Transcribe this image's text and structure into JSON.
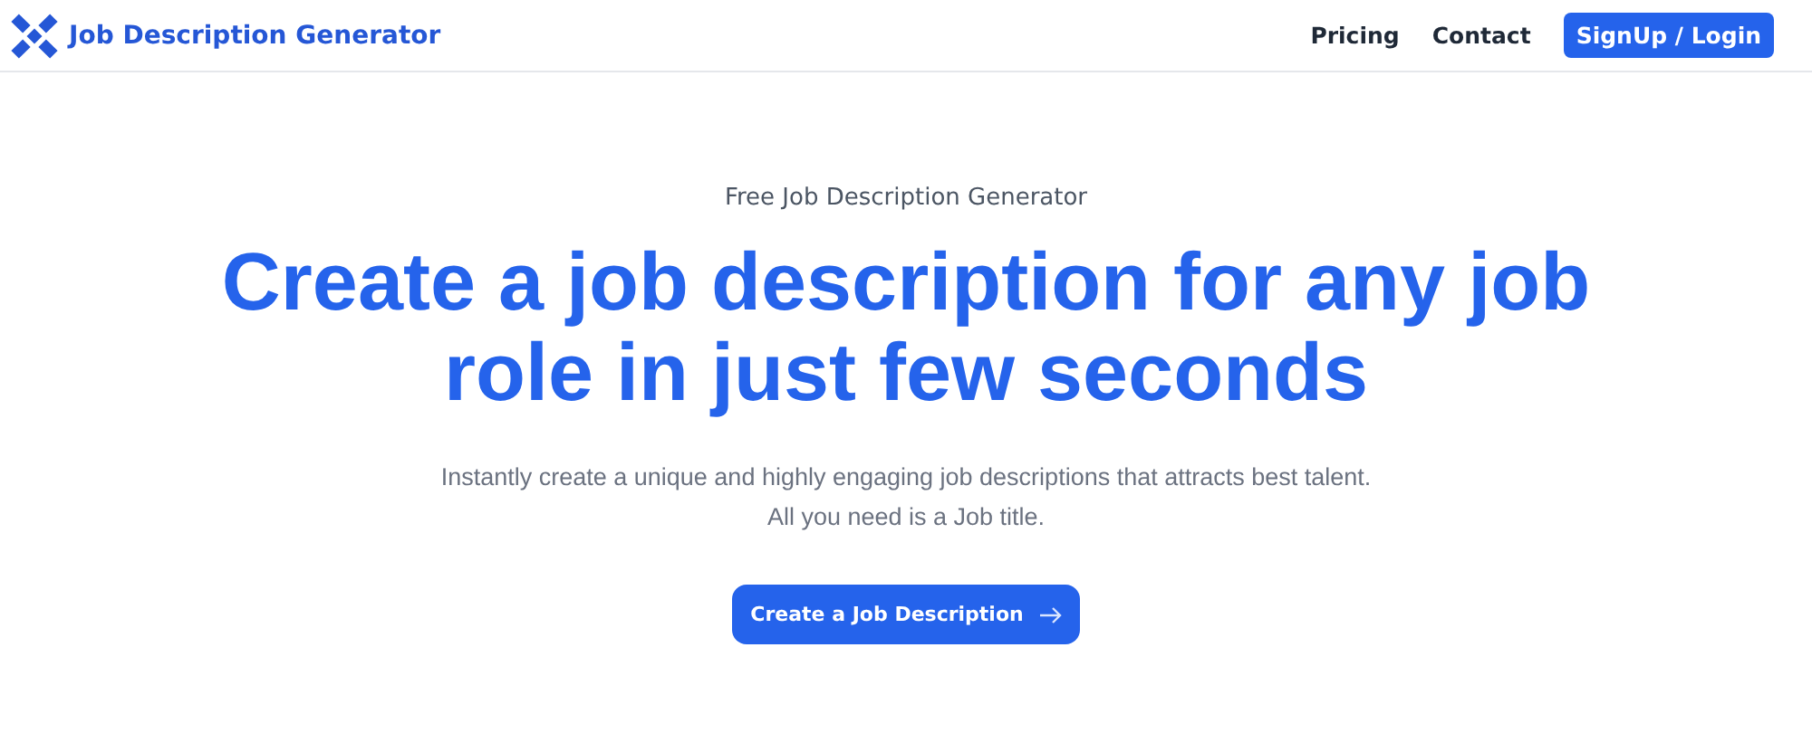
{
  "header": {
    "brand": "Job Description Generator",
    "nav": [
      {
        "label": "Pricing",
        "kind": "link"
      },
      {
        "label": "Contact",
        "kind": "link"
      },
      {
        "label": "SignUp / Login",
        "kind": "button"
      }
    ]
  },
  "hero": {
    "eyebrow": "Free Job Description Generator",
    "headline": "Create a job description for any job role in just few seconds",
    "lines": [
      "Instantly create a unique and highly engaging job descriptions that attracts best talent.",
      "All you need is a Job title."
    ],
    "cta": "Create a Job Description"
  }
}
